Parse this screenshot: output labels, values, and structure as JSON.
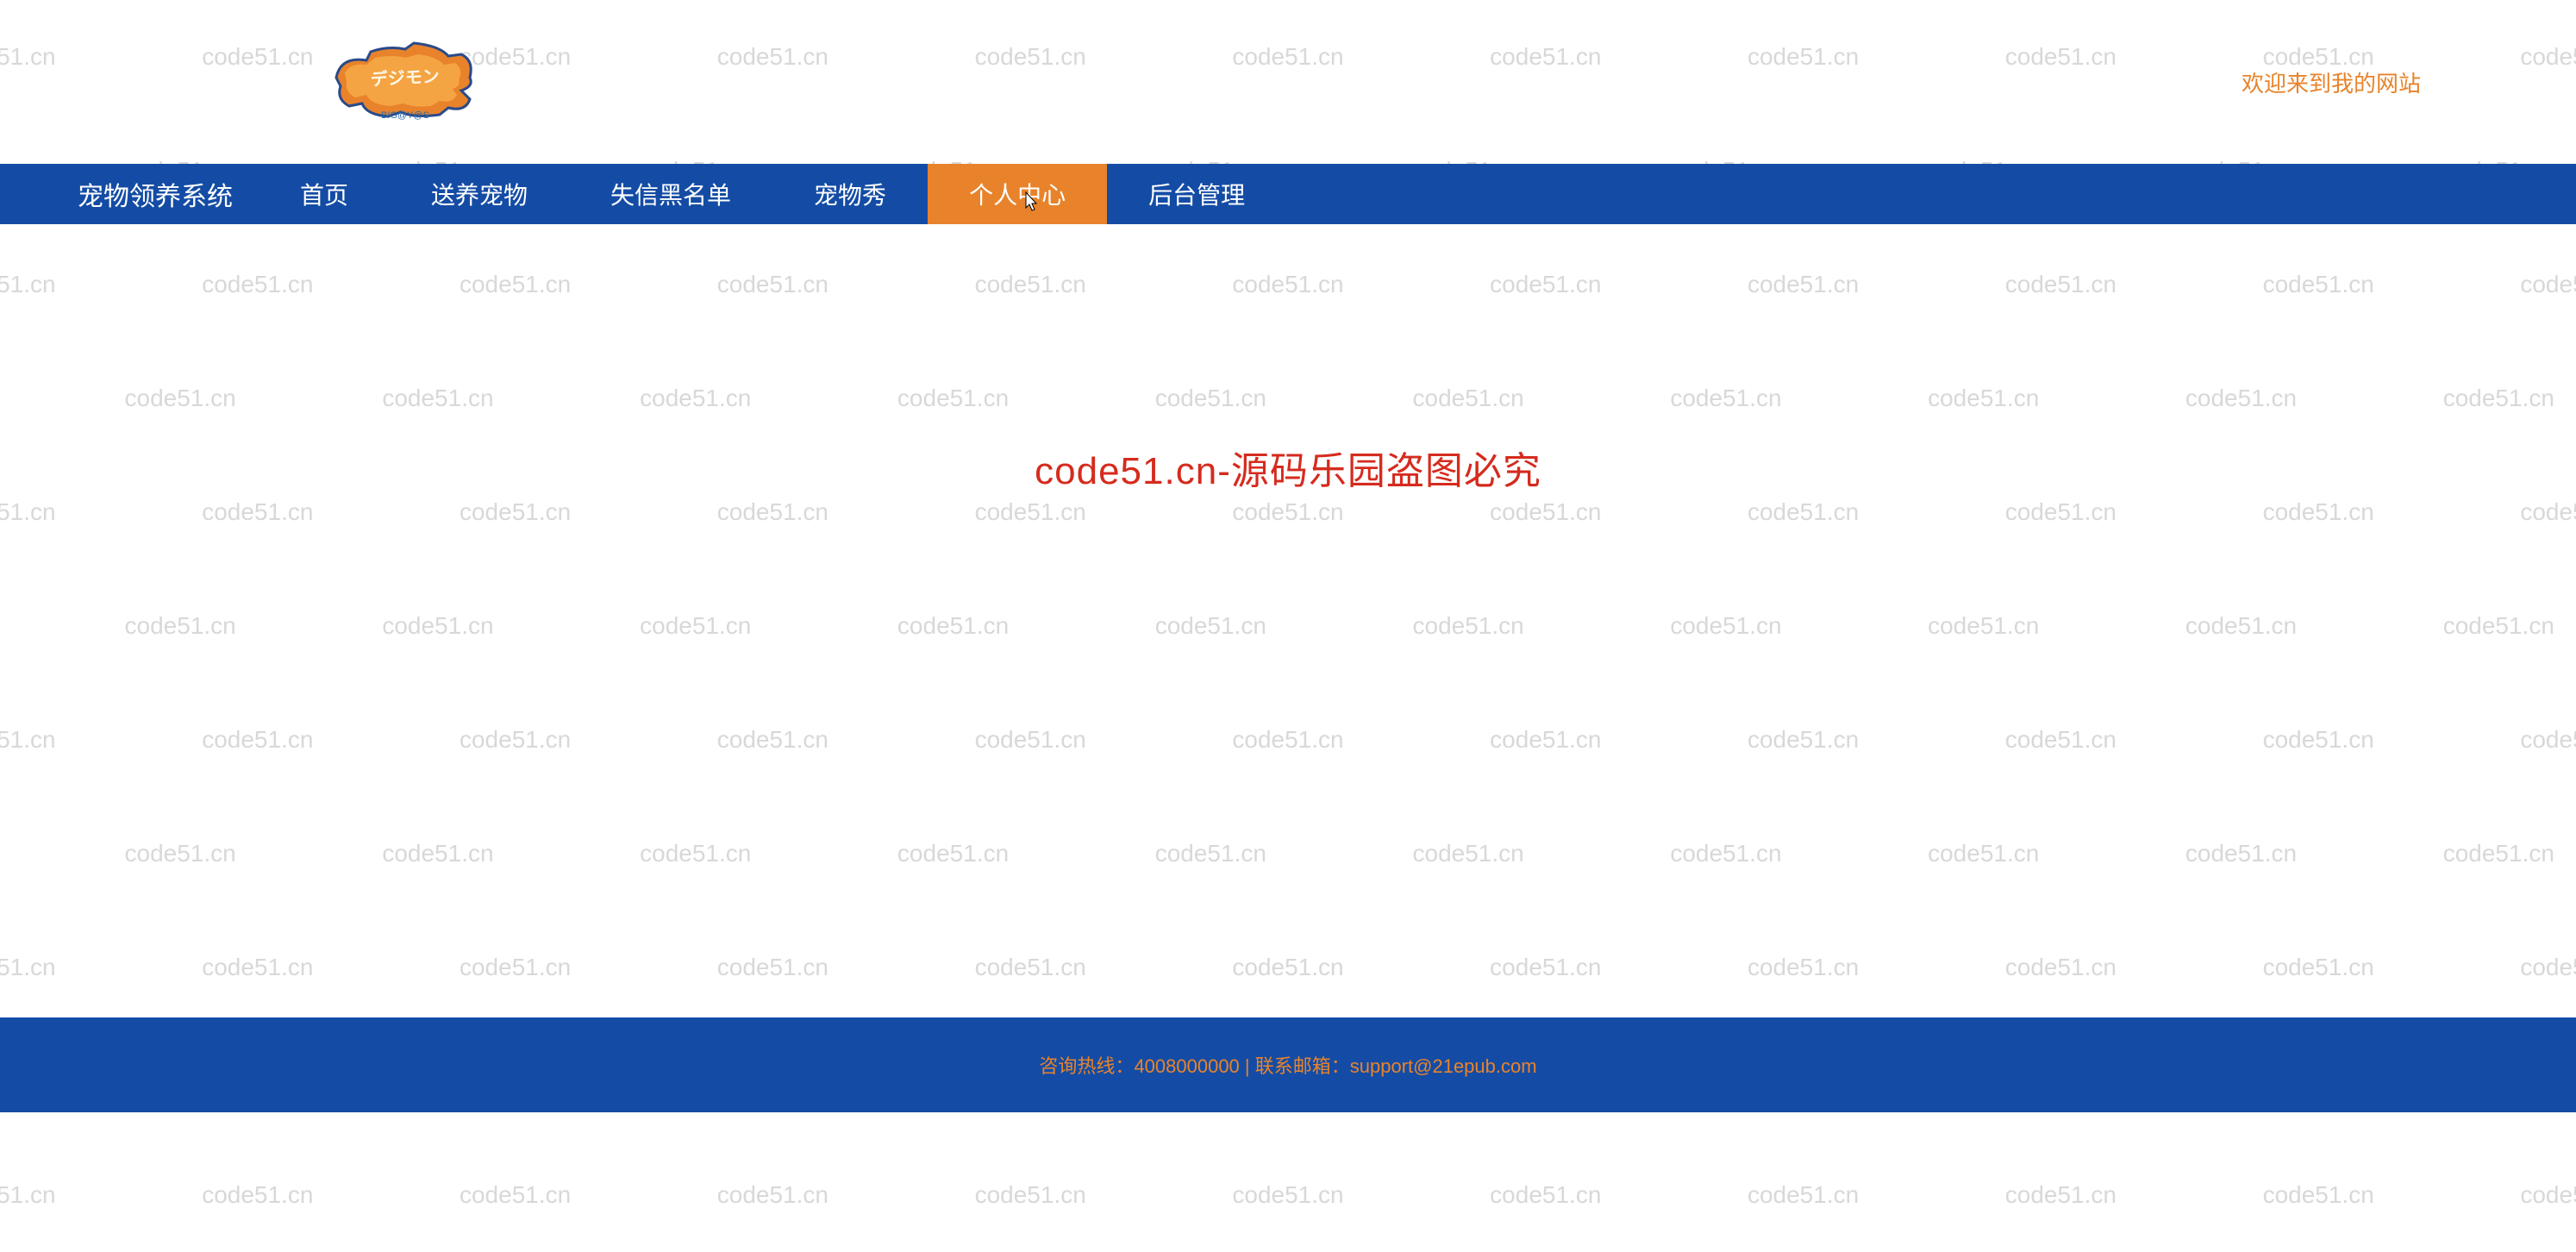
{
  "watermark": "code51.cn",
  "header": {
    "logo_sub": "BIG@Y@S",
    "welcome": "欢迎来到我的网站"
  },
  "nav": {
    "brand": "宠物领养系统",
    "items": [
      {
        "label": "首页",
        "active": false
      },
      {
        "label": "送养宠物",
        "active": false
      },
      {
        "label": "失信黑名单",
        "active": false
      },
      {
        "label": "宠物秀",
        "active": false
      },
      {
        "label": "个人中心",
        "active": true
      },
      {
        "label": "后台管理",
        "active": false
      }
    ]
  },
  "center_watermark": "code51.cn-源码乐园盗图必究",
  "footer": {
    "hotline_label": "咨询热线：",
    "hotline_value": "4008000000",
    "separator": " | ",
    "email_label": "联系邮箱：",
    "email_value": "support@21epub.com"
  }
}
